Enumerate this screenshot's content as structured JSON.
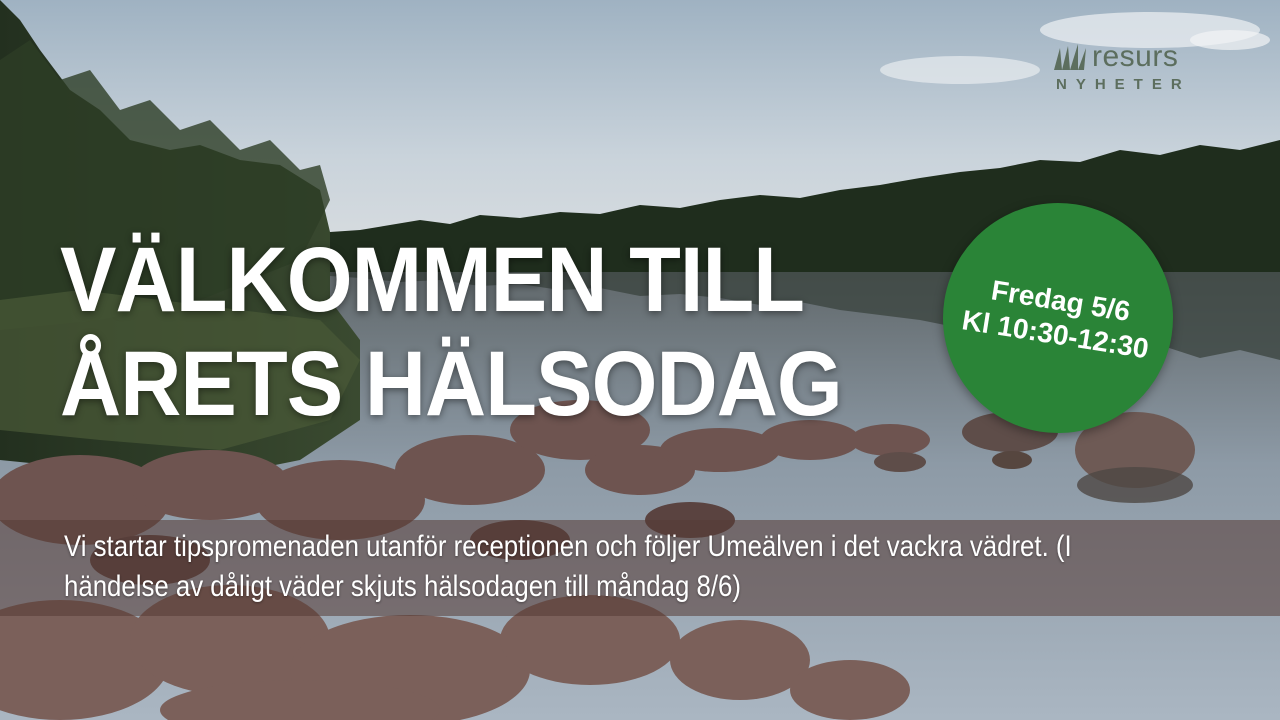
{
  "headline": {
    "line1": "VÄLKOMMEN TILL",
    "line2": "ÅRETS HÄLSODAG"
  },
  "badge": {
    "line1": "Fredag 5/6",
    "line2": "Kl 10:30-12:30",
    "color": "#2a8437"
  },
  "banner": {
    "text": "Vi startar tipspromenaden utanför receptionen och följer Umeälven i det vackra vädret. (I händelse av dåligt väder skjuts hälsodagen till måndag 8/6)"
  },
  "logo": {
    "word": "resurs",
    "sub": "NYHETER"
  },
  "background": {
    "icon": "lake-forest-landscape-photo"
  }
}
